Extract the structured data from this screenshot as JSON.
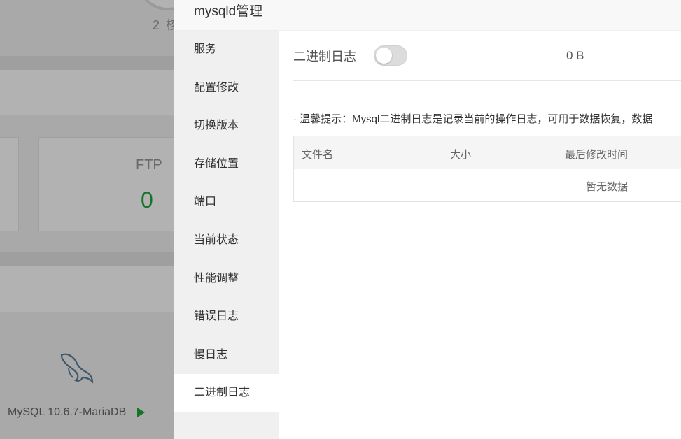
{
  "background": {
    "core_text": "2 核",
    "ftp_label": "FTP",
    "ftp_value": "0",
    "mysql_version": "MySQL 10.6.7-MariaDB"
  },
  "dialog": {
    "title": "mysqld管理",
    "sidebar": {
      "items": [
        {
          "label": "服务"
        },
        {
          "label": "配置修改"
        },
        {
          "label": "切换版本"
        },
        {
          "label": "存储位置"
        },
        {
          "label": "端口"
        },
        {
          "label": "当前状态"
        },
        {
          "label": "性能调整"
        },
        {
          "label": "错误日志"
        },
        {
          "label": "慢日志"
        },
        {
          "label": "二进制日志"
        }
      ],
      "active_index": 9
    },
    "binlog": {
      "label": "二进制日志",
      "enabled": false,
      "size": "0 B"
    },
    "tip": "· 温馨提示：Mysql二进制日志是记录当前的操作日志，可用于数据恢复，数据",
    "table": {
      "headers": [
        "文件名",
        "大小",
        "最后修改时间"
      ],
      "empty_text": "暂无数据"
    }
  },
  "colors": {
    "accent": "#20a53a",
    "overlay": "rgba(0,0,0,0.3)"
  }
}
